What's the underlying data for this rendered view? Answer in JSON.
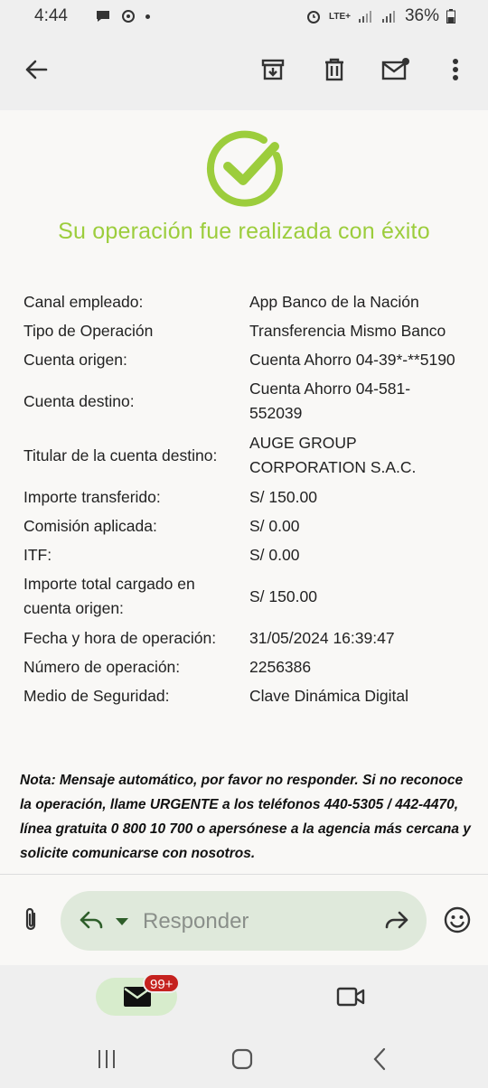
{
  "status_bar": {
    "time": "4:44",
    "network": "LTE+",
    "battery": "36%"
  },
  "toolbar": {
    "back": "arrow-left-icon",
    "archive": "archive-icon",
    "delete": "trash-icon",
    "mark_unread": "mail-unread-icon",
    "more": "more-vert-icon"
  },
  "receipt": {
    "title": "Su operación fue realizada con éxito",
    "rows": [
      {
        "label": "Canal empleado:",
        "value": "App Banco de la Nación"
      },
      {
        "label": "Tipo de Operación",
        "value": "Transferencia Mismo Banco"
      },
      {
        "label": "Cuenta origen:",
        "value": "Cuenta Ahorro 04-39*-**5190"
      },
      {
        "label": "Cuenta destino:",
        "value": "Cuenta Ahorro 04-581-552039"
      },
      {
        "label": "Titular de la cuenta destino:",
        "value": "AUGE GROUP CORPORATION S.A.C."
      },
      {
        "label": "Importe transferido:",
        "value": "S/ 150.00"
      },
      {
        "label": "Comisión aplicada:",
        "value": "S/ 0.00"
      },
      {
        "label": "ITF:",
        "value": "S/ 0.00"
      },
      {
        "label": "Importe total cargado en cuenta origen:",
        "value": "S/ 150.00"
      },
      {
        "label": "Fecha y hora de operación:",
        "value": "31/05/2024 16:39:47"
      },
      {
        "label": "Número de operación:",
        "value": "2256386"
      },
      {
        "label": "Medio de Seguridad:",
        "value": "Clave Dinámica Digital"
      }
    ],
    "note": "Nota: Mensaje automático, por favor no responder. Si no reconoce la operación, llame URGENTE a los teléfonos 440-5305 / 442-4470, línea gratuita 0 800 10 700 o apersónese a la agencia más cercana y solicite comunicarse con nosotros."
  },
  "reply": {
    "placeholder": "Responder"
  },
  "bottom_nav": {
    "mail_badge": "99+"
  },
  "colors": {
    "success_green": "#9ccd3c",
    "reply_pill": "#dfe9db",
    "badge_red": "#c5221f"
  }
}
